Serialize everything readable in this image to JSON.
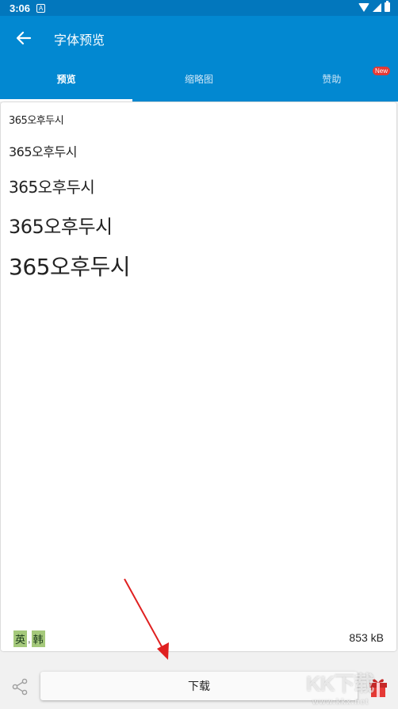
{
  "status_bar": {
    "time": "3:06",
    "notif_glyph": "A"
  },
  "app_bar": {
    "title": "字体预览",
    "back_icon": "arrow-back-icon"
  },
  "tabs": [
    {
      "label": "预览",
      "active": true
    },
    {
      "label": "缩略图",
      "active": false
    },
    {
      "label": "赞助",
      "active": false,
      "badge": "New"
    }
  ],
  "preview": {
    "samples": [
      "365오후두시",
      "365오후두시",
      "365오후두시",
      "365오후두시",
      "365오후두시"
    ],
    "languages": [
      "英",
      "韩"
    ],
    "language_separator": ",",
    "file_size": "853 kB"
  },
  "bottom": {
    "download_label": "下载",
    "share_icon": "share-icon",
    "gift_icon": "gift-icon"
  },
  "watermark": {
    "logo": "KK下载",
    "url": "www.kkx.net"
  },
  "colors": {
    "status_bar": "#0277bd",
    "primary": "#0288d1",
    "badge": "#e53935",
    "lang_tag": "#a5c97b",
    "arrow": "#e02020"
  }
}
